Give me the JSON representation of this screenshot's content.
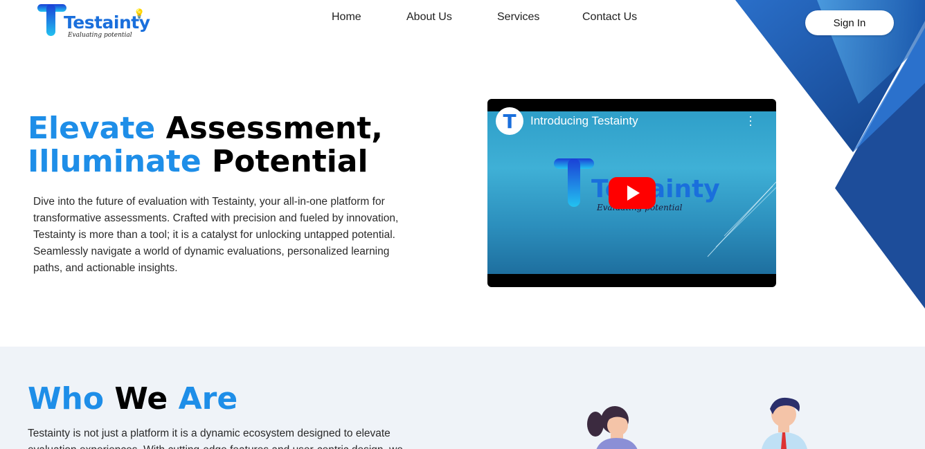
{
  "brand": {
    "name": "Testainty",
    "tagline": "Evaluating potential",
    "primary_color": "#1e8ee8"
  },
  "nav": {
    "items": [
      "Home",
      "About Us",
      "Services",
      "Contact Us"
    ]
  },
  "header": {
    "sign_in_label": "Sign In"
  },
  "hero": {
    "title_line1_accent": "Elevate",
    "title_line1_rest": "Assessment,",
    "title_line2_accent": "Illuminate",
    "title_line2_rest": "Potential",
    "description": "Dive into the future of evaluation with Testainty, your all-in-one platform for transformative assessments. Crafted with precision and fueled by innovation, Testainty is more than a tool; it is a catalyst for unlocking untapped potential. Seamlessly navigate a world of dynamic evaluations, personalized learning paths, and actionable insights."
  },
  "video": {
    "channel_initial": "T",
    "title": "Introducing Testainty",
    "logo_word": "Testainty",
    "logo_tagline": "Evaluating potential"
  },
  "who": {
    "title_accent_1": "Who",
    "title_mid": "We",
    "title_accent_2": "Are",
    "description": "Testainty is not just a platform it is a dynamic ecosystem designed to elevate evaluation experiences. With cutting-edge features and user-centric design, we"
  },
  "icons": [
    "bulb-icon",
    "more-vert-icon",
    "play-icon"
  ]
}
